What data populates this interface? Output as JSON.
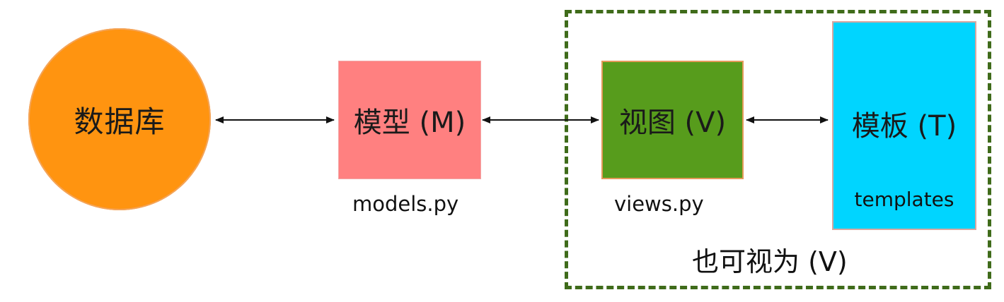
{
  "nodes": {
    "database": {
      "label": "数据库",
      "color": "#ff9410"
    },
    "model": {
      "label": "模型 (M)",
      "caption": "models.py",
      "color": "#ff8080"
    },
    "view": {
      "label": "视图 (V)",
      "caption": "views.py",
      "color": "#579c1c"
    },
    "template": {
      "label": "模板 (T)",
      "caption": "templates",
      "color": "#00d5ff"
    }
  },
  "group": {
    "label": "也可视为 (V)",
    "border_color": "#3f6b1a",
    "border_style": "dashed",
    "members": [
      "view",
      "template"
    ]
  },
  "edges": [
    {
      "from": "database",
      "to": "model",
      "direction": "bidirectional"
    },
    {
      "from": "model",
      "to": "view",
      "direction": "bidirectional"
    },
    {
      "from": "view",
      "to": "template",
      "direction": "bidirectional"
    }
  ]
}
